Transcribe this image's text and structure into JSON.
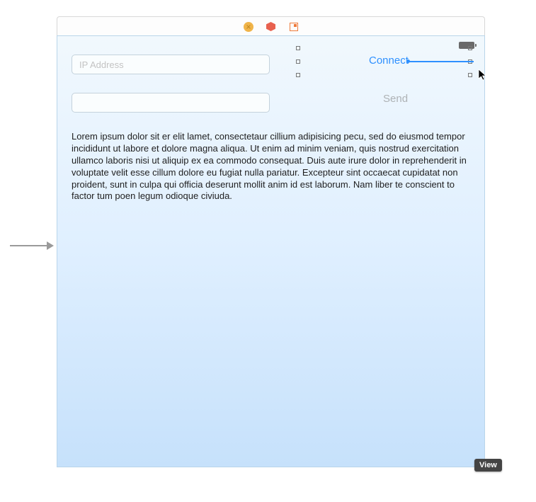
{
  "inputs": {
    "ip_placeholder": "IP Address",
    "message_placeholder": ""
  },
  "buttons": {
    "connect": "Connect",
    "send": "Send"
  },
  "body_text": "Lorem ipsum dolor sit er elit lamet, consectetaur cillium adipisicing pecu, sed do eiusmod tempor incididunt ut labore et dolore magna aliqua. Ut enim ad minim veniam, quis nostrud exercitation ullamco laboris nisi ut aliquip ex ea commodo consequat. Duis aute irure dolor in reprehenderit in voluptate velit esse cillum dolore eu fugiat nulla pariatur. Excepteur sint occaecat cupidatat non proident, sunt in culpa qui officia deserunt mollit anim id est laborum. Nam liber te conscient to factor tum poen legum odioque civiuda.",
  "tooltip": "View",
  "colors": {
    "accent": "#2e90ff",
    "disabled_text": "#aeb2b5"
  }
}
